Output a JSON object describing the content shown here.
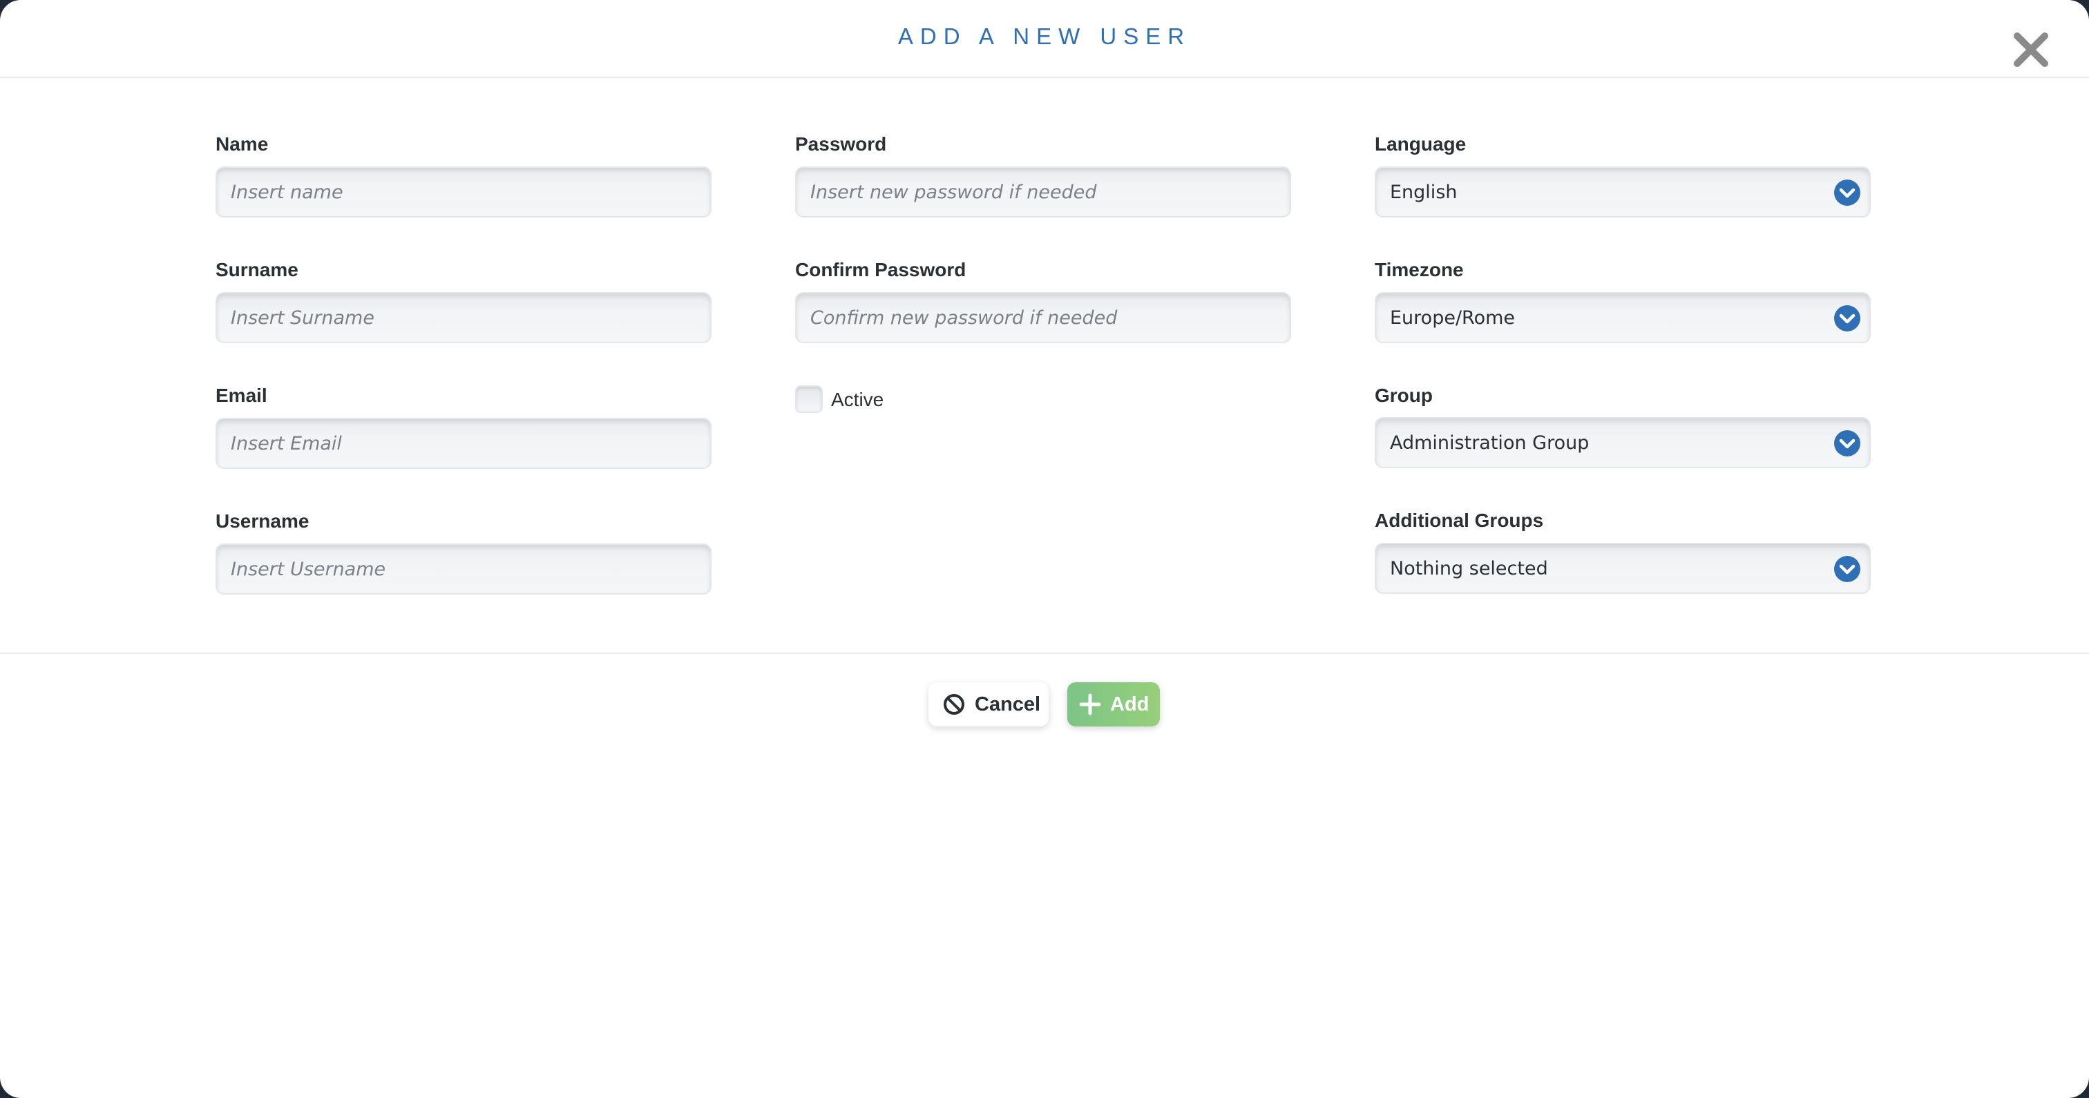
{
  "modal": {
    "title": "ADD A NEW USER",
    "close_icon": "close-icon"
  },
  "form": {
    "name": {
      "label": "Name",
      "placeholder": "Insert name",
      "value": ""
    },
    "surname": {
      "label": "Surname",
      "placeholder": "Insert Surname",
      "value": ""
    },
    "email": {
      "label": "Email",
      "placeholder": "Insert Email",
      "value": ""
    },
    "username": {
      "label": "Username",
      "placeholder": "Insert Username",
      "value": ""
    },
    "password": {
      "label": "Password",
      "placeholder": "Insert new password if needed",
      "value": ""
    },
    "confirm_password": {
      "label": "Confirm Password",
      "placeholder": "Confirm new password if needed",
      "value": ""
    },
    "active": {
      "label": "Active",
      "checked": false
    },
    "language": {
      "label": "Language",
      "selected": "English"
    },
    "timezone": {
      "label": "Timezone",
      "selected": "Europe/Rome"
    },
    "group": {
      "label": "Group",
      "selected": "Administration Group"
    },
    "additional_groups": {
      "label": "Additional Groups",
      "selected": "Nothing selected"
    }
  },
  "footer": {
    "cancel_label": "Cancel",
    "cancel_icon": "ban-icon",
    "add_label": "Add",
    "add_icon": "plus-icon"
  },
  "colors": {
    "title": "#2f6fb5",
    "chevron": "#2f6fb5",
    "add_button_start": "#7cc487",
    "add_button_end": "#97cf7a",
    "close_icon": "#8a8a8a"
  }
}
